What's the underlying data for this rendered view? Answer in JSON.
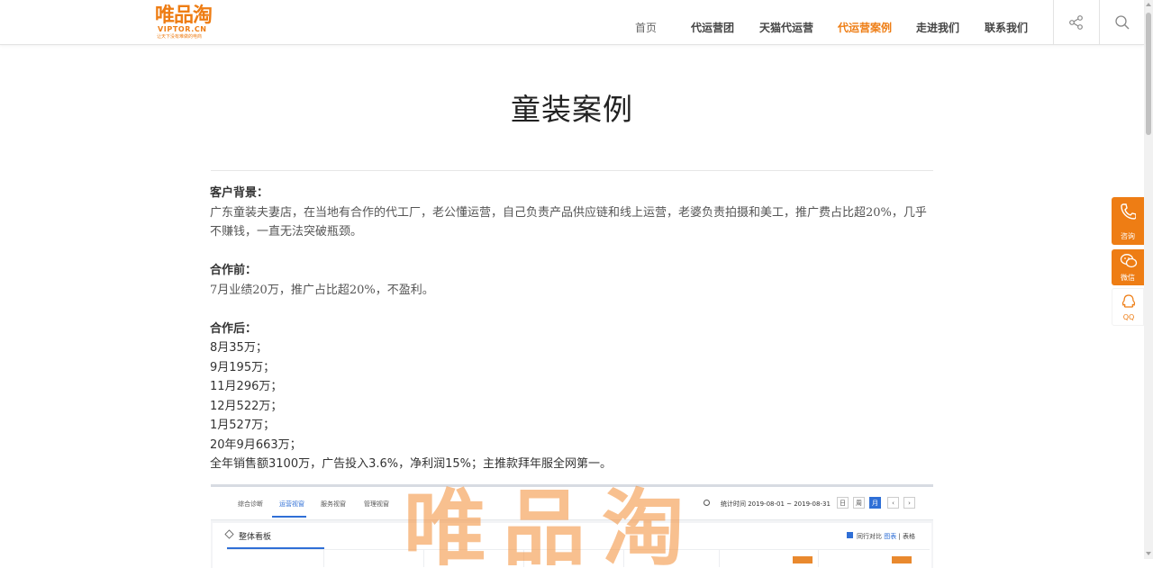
{
  "header": {
    "logo": {
      "main": "唯品淘",
      "sub": "VIPTOR.CN",
      "tagline": "让天下没有难做的电商"
    },
    "nav": [
      {
        "label": "首页",
        "state": "normal"
      },
      {
        "label": "代运营团",
        "state": "bold"
      },
      {
        "label": "天猫代运营",
        "state": "bold"
      },
      {
        "label": "代运营案例",
        "state": "active"
      },
      {
        "label": "走进我们",
        "state": "bold"
      },
      {
        "label": "联系我们",
        "state": "bold"
      }
    ],
    "share_icon": "share-icon",
    "search_icon": "search-icon"
  },
  "page": {
    "title": "童装案例"
  },
  "article": {
    "background_heading": "客户背景：",
    "background_text": "广东童装夫妻店，在当地有合作的代工厂，老公懂运营，自己负责产品供应链和线上运营，老婆负责拍摄和美工，推广费占比超20%，几乎不赚钱，一直无法突破瓶颈。",
    "before_heading": "合作前：",
    "before_text": "7月业绩20万，推广占比超20%，不盈利。",
    "after_heading": "合作后：",
    "after_items": [
      "8月35万；",
      "9月195万；",
      "11月296万；",
      "12月522万；",
      "1月527万；",
      "20年9月663万；",
      "全年销售额3100万，广告投入3.6%，净利润15%；主推款拜年服全网第一。"
    ]
  },
  "screenshot": {
    "tabs": [
      "综合诊断",
      "运营视窗",
      "服务视窗",
      "管理视窗"
    ],
    "active_tab": "运营视窗",
    "stat_period": "统计时间 2019-08-01 ~ 2019-08-31",
    "period_buttons": [
      "日",
      "周",
      "月",
      "‹",
      "›"
    ],
    "selected_period": "月",
    "panel_title": "整体看板",
    "compare_label": "同行对比",
    "chart_link": "图表",
    "table_link": "表格",
    "watermark": "唯品淘"
  },
  "sidebar": {
    "consult_label": "咨询",
    "wechat_label": "微信",
    "qq_label": "QQ"
  },
  "colors": {
    "accent": "#ee7d14",
    "blue": "#2f6fd6",
    "text": "#555555"
  }
}
